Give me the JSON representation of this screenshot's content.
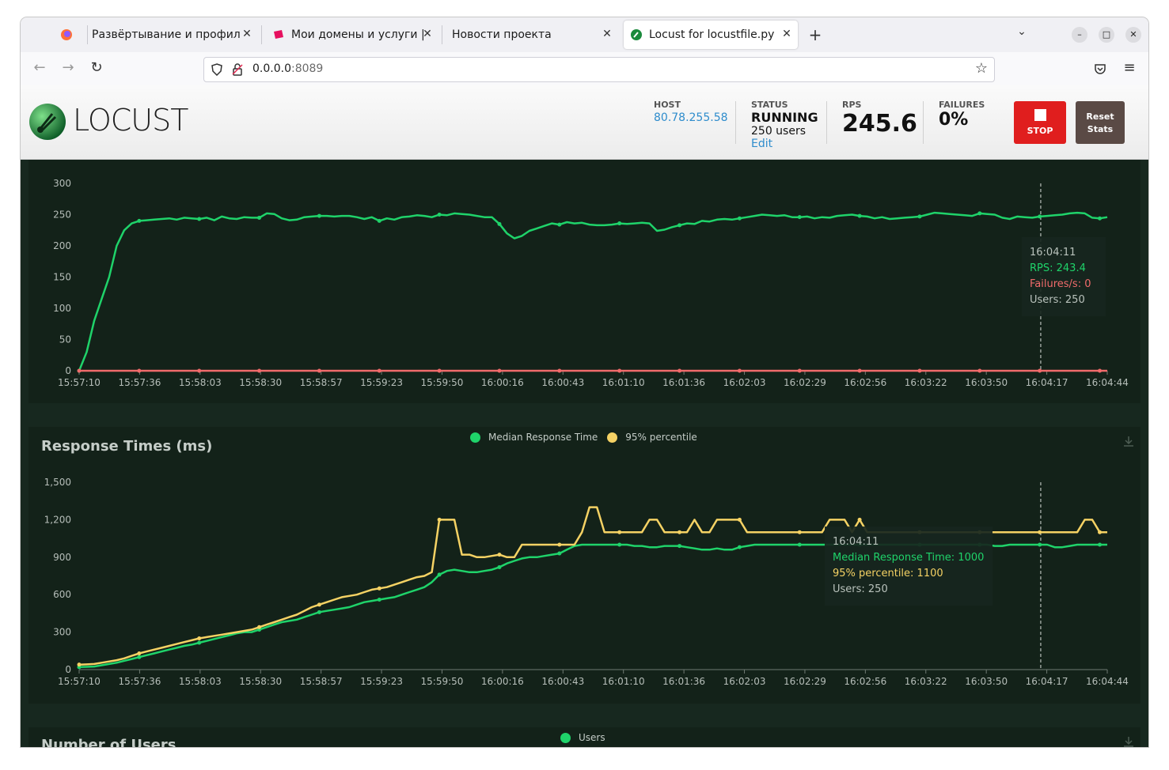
{
  "browser": {
    "tabs": [
      {
        "title": "Развёртывание и профилир"
      },
      {
        "title": "Мои домены и услуги | R"
      },
      {
        "title": "Новости проекта"
      },
      {
        "title": "Locust for locustfile.py"
      }
    ],
    "url_host": "0.0.0.0",
    "url_port": ":8089"
  },
  "locust": {
    "logo": "LOCUST",
    "host_label": "HOST",
    "host_value": "80.78.255.58",
    "status_label": "STATUS",
    "status_value": "RUNNING",
    "users_text": "250 users",
    "edit_label": "Edit",
    "rps_label": "RPS",
    "rps_value": "245.6",
    "failures_label": "FAILURES",
    "failures_value": "0%",
    "stop_label": "STOP",
    "reset_label": "Reset",
    "reset_label2": "Stats"
  },
  "colors": {
    "rps": "#1fd36a",
    "failures": "#f06b6b",
    "p95": "#f5d264",
    "background": "#17281f"
  },
  "rps_chart": {
    "tooltip": {
      "time": "16:04:11",
      "rps": "RPS: 243.4",
      "failures": "Failures/s: 0",
      "users": "Users: 250"
    }
  },
  "response_chart": {
    "title": "Response Times (ms)",
    "legend_median": "Median Response Time",
    "legend_p95": "95% percentile",
    "tooltip": {
      "time": "16:04:11",
      "median": "Median Response Time: 1000",
      "p95": "95% percentile: 1100",
      "users": "Users: 250"
    }
  },
  "users_chart": {
    "title": "Number of Users",
    "legend_users": "Users"
  },
  "chart_data": [
    {
      "type": "line",
      "x_ticks": [
        "15:57:10",
        "15:57:36",
        "15:58:03",
        "15:58:30",
        "15:58:57",
        "15:59:23",
        "15:59:50",
        "16:00:16",
        "16:00:43",
        "16:01:10",
        "16:01:36",
        "16:02:03",
        "16:02:29",
        "16:02:56",
        "16:03:22",
        "16:03:50",
        "16:04:17",
        "16:04:44"
      ],
      "y_ticks": [
        "0",
        "50",
        "100",
        "150",
        "200",
        "250",
        "300"
      ],
      "ylim": [
        0,
        300
      ],
      "grid": false,
      "series": [
        {
          "name": "RPS",
          "values": [
            0,
            30,
            80,
            115,
            150,
            200,
            225,
            236,
            240,
            241,
            242,
            243,
            244,
            242,
            245,
            244,
            243,
            245,
            241,
            247,
            244,
            243,
            246,
            245,
            245,
            252,
            251,
            244,
            241,
            242,
            246,
            247,
            248,
            248,
            247,
            248,
            248,
            246,
            243,
            246,
            240,
            244,
            242,
            246,
            247,
            249,
            248,
            246,
            250,
            249,
            252,
            251,
            250,
            248,
            246,
            246,
            235,
            220,
            212,
            216,
            224,
            228,
            232,
            236,
            234,
            238,
            236,
            237,
            234,
            233,
            233,
            234,
            236,
            235,
            236,
            237,
            236,
            224,
            226,
            230,
            233,
            236,
            235,
            240,
            239,
            242,
            243,
            242,
            244,
            246,
            248,
            250,
            249,
            248,
            249,
            246,
            246,
            247,
            244,
            246,
            245,
            248,
            249,
            250,
            248,
            247,
            244,
            246,
            243,
            244,
            245,
            246,
            247,
            250,
            253,
            252,
            251,
            250,
            249,
            248,
            252,
            251,
            250,
            245,
            243,
            247,
            246,
            245,
            247,
            248,
            249,
            250,
            252,
            253,
            252,
            245,
            244,
            246
          ]
        },
        {
          "name": "Failures/s",
          "values": [
            0,
            0,
            0,
            0,
            0,
            0,
            0,
            0,
            0,
            0,
            0,
            0,
            0,
            0,
            0,
            0,
            0,
            0,
            0,
            0,
            0,
            0,
            0,
            0,
            0,
            0,
            0,
            0,
            0,
            0,
            0,
            0,
            0,
            0,
            0,
            0,
            0,
            0,
            0,
            0,
            0,
            0,
            0,
            0,
            0,
            0,
            0,
            0,
            0,
            0,
            0,
            0,
            0,
            0,
            0,
            0,
            0,
            0,
            0,
            0,
            0,
            0,
            0,
            0,
            0,
            0,
            0,
            0,
            0,
            0,
            0,
            0,
            0,
            0,
            0,
            0,
            0,
            0,
            0,
            0,
            0,
            0,
            0,
            0,
            0,
            0,
            0,
            0,
            0,
            0,
            0,
            0,
            0,
            0,
            0,
            0,
            0,
            0,
            0,
            0,
            0,
            0,
            0,
            0,
            0,
            0,
            0,
            0,
            0,
            0,
            0,
            0,
            0,
            0,
            0,
            0,
            0,
            0,
            0,
            0,
            0,
            0,
            0,
            0,
            0,
            0,
            0,
            0,
            0,
            0,
            0,
            0,
            0,
            0,
            0,
            0,
            0,
            0
          ]
        }
      ]
    },
    {
      "type": "line",
      "title": "Response Times (ms)",
      "x_ticks": [
        "15:57:10",
        "15:57:36",
        "15:58:03",
        "15:58:30",
        "15:58:57",
        "15:59:23",
        "15:59:50",
        "16:00:16",
        "16:00:43",
        "16:01:10",
        "16:01:36",
        "16:02:03",
        "16:02:29",
        "16:02:56",
        "16:03:22",
        "16:03:50",
        "16:04:17",
        "16:04:44"
      ],
      "y_ticks": [
        "0",
        "300",
        "600",
        "900",
        "1,200",
        "1,500"
      ],
      "ylim": [
        0,
        1500
      ],
      "grid": false,
      "legend": "top-center",
      "series": [
        {
          "name": "Median Response Time",
          "values": [
            20,
            22,
            25,
            35,
            45,
            55,
            70,
            85,
            100,
            115,
            130,
            145,
            160,
            175,
            190,
            200,
            215,
            230,
            245,
            260,
            275,
            290,
            300,
            300,
            320,
            340,
            360,
            380,
            390,
            400,
            420,
            440,
            460,
            470,
            480,
            490,
            500,
            520,
            540,
            550,
            560,
            570,
            580,
            600,
            620,
            640,
            660,
            700,
            760,
            790,
            800,
            790,
            780,
            780,
            790,
            800,
            820,
            850,
            870,
            890,
            900,
            900,
            910,
            920,
            930,
            960,
            990,
            1000,
            1000,
            1000,
            1000,
            1000,
            1000,
            1000,
            990,
            990,
            980,
            980,
            990,
            990,
            990,
            980,
            970,
            960,
            960,
            970,
            960,
            960,
            980,
            990,
            1000,
            1000,
            1000,
            1000,
            1000,
            1000,
            1000,
            1000,
            1000,
            1000,
            1000,
            1000,
            1000,
            1000,
            1000,
            1000,
            1000,
            1000,
            1000,
            1000,
            1000,
            1000,
            1000,
            1000,
            1000,
            1000,
            1000,
            1000,
            1000,
            1000,
            1000,
            1000,
            990,
            990,
            1000,
            1000,
            1000,
            1000,
            1000,
            1000,
            980,
            980,
            990,
            1000,
            1000,
            1000,
            1000,
            1000
          ]
        },
        {
          "name": "95% percentile",
          "values": [
            40,
            42,
            45,
            55,
            65,
            75,
            90,
            110,
            130,
            145,
            160,
            175,
            190,
            205,
            220,
            235,
            250,
            260,
            270,
            280,
            290,
            300,
            310,
            320,
            340,
            360,
            380,
            400,
            420,
            440,
            470,
            500,
            520,
            540,
            560,
            580,
            590,
            600,
            620,
            640,
            650,
            660,
            680,
            700,
            720,
            740,
            750,
            780,
            1200,
            1200,
            1200,
            920,
            920,
            900,
            900,
            910,
            920,
            900,
            900,
            1000,
            1000,
            1000,
            1000,
            1000,
            1000,
            1000,
            1000,
            1100,
            1300,
            1300,
            1100,
            1100,
            1100,
            1100,
            1100,
            1100,
            1200,
            1200,
            1100,
            1100,
            1100,
            1100,
            1200,
            1100,
            1100,
            1200,
            1200,
            1200,
            1200,
            1100,
            1100,
            1100,
            1100,
            1100,
            1100,
            1100,
            1100,
            1100,
            1100,
            1100,
            1200,
            1200,
            1200,
            1100,
            1200,
            1100,
            1100,
            1100,
            1100,
            1100,
            1100,
            1100,
            1100,
            1100,
            1100,
            1100,
            1100,
            1100,
            1100,
            1100,
            1100,
            1100,
            1100,
            1100,
            1100,
            1100,
            1100,
            1100,
            1100,
            1100,
            1100,
            1100,
            1100,
            1100,
            1200,
            1200,
            1100,
            1100
          ]
        }
      ]
    }
  ]
}
